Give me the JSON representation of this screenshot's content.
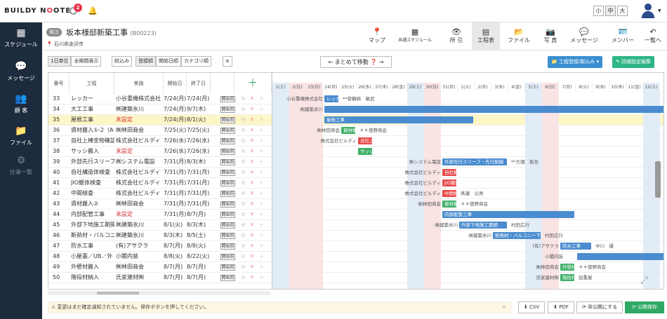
{
  "app": {
    "logo": "BUILDY NOOTE",
    "notif_count": "2"
  },
  "font_size": [
    "小",
    "中",
    "大"
  ],
  "sidebar": [
    {
      "label": "スケジュール",
      "icon": "▦"
    },
    {
      "label": "メッセージ",
      "icon": "✉"
    },
    {
      "label": "顧 客",
      "icon": "👥"
    },
    {
      "label": "ファイル",
      "icon": "📁"
    },
    {
      "label": "仕事一覧",
      "icon": "⚙"
    }
  ],
  "project": {
    "tag": "発注",
    "title": "坂本様邸新築工事",
    "code": "(B00223)",
    "location": "石川県金沢市"
  },
  "nav": [
    {
      "label": "マップ",
      "icon": "📍"
    },
    {
      "label": "共通スケジュール",
      "icon": "▦"
    },
    {
      "label": "所 引",
      "icon": "👁"
    },
    {
      "label": "工程表",
      "icon": "▤"
    },
    {
      "label": "ファイル",
      "icon": "📂"
    },
    {
      "label": "写 真",
      "icon": "📷"
    },
    {
      "label": "メッセージ",
      "icon": "💬"
    },
    {
      "label": "メンバー",
      "icon": "🪪"
    },
    {
      "label": "一覧へ",
      "icon": "↶"
    }
  ],
  "toolbar": {
    "view": [
      "1日単位",
      "全期間表示"
    ],
    "filter": "絞込み",
    "sort": [
      "登録順",
      "開始日順",
      "カテゴリ順"
    ],
    "move": "まとめて移動",
    "register": "工程登録/取込み",
    "settings": "詳細設定編集"
  },
  "columns": {
    "no": "番号",
    "name": "工程",
    "contractor": "実施",
    "start": "開始日",
    "end": "終了日",
    "start_btn": "開始前"
  },
  "dates": [
    "1(土)",
    "2(日)",
    "23(日)",
    "24(月)",
    "25(火)",
    "26(水)",
    "27(木)",
    "28(金)",
    "29(土)",
    "30(日)",
    "31(月)",
    "1(火)",
    "2(水)",
    "3(木)",
    "4(金)",
    "5(土)",
    "6(日)",
    "7(月)",
    "8(火)",
    "9(水)",
    "10(木)",
    "11(金)",
    "12(土)"
  ],
  "rows": [
    {
      "no": "33",
      "name": "レッカー",
      "c": "小谷重機株式会社",
      "s": "7/24(月)",
      "e": "7/24(月)",
      "red": false
    },
    {
      "no": "34",
      "name": "大工工事",
      "c": "㈱建築氷川",
      "s": "7/24(月)",
      "e": "9/7(木)",
      "red": false
    },
    {
      "no": "35",
      "name": "屋根工事",
      "c": "未設定",
      "s": "7/24(月)",
      "e": "8/1(火)",
      "red": true
    },
    {
      "no": "36",
      "name": "資材搬入①-2（A",
      "c": "㈱林田商会",
      "s": "7/25(火)",
      "e": "7/25(火)",
      "red": false
    },
    {
      "no": "37",
      "name": "自社上棟金物確認",
      "c": "株式会社ビルディ",
      "s": "7/26(水)",
      "e": "7/26(水)",
      "red": false
    },
    {
      "no": "38",
      "name": "サッシ搬入",
      "c": "未設定",
      "s": "7/26(水)",
      "e": "7/26(水)",
      "red": true
    },
    {
      "no": "39",
      "name": "外部先行スリーブ",
      "c": "㈱システム電設",
      "s": "7/31(月)",
      "e": "8/3(木)",
      "red": false
    },
    {
      "no": "40",
      "name": "自社構造体検査",
      "c": "株式会社ビルディ",
      "s": "7/31(月)",
      "e": "7/31(月)",
      "red": false
    },
    {
      "no": "41",
      "name": "JIO躯体検査",
      "c": "株式会社ビルディ",
      "s": "7/31(月)",
      "e": "7/31(月)",
      "red": false
    },
    {
      "no": "42",
      "name": "中間検査",
      "c": "株式会社ビルディ",
      "s": "7/31(月)",
      "e": "7/31(月)",
      "red": false
    },
    {
      "no": "43",
      "name": "資材搬入②",
      "c": "㈱林田商会",
      "s": "7/31(月)",
      "e": "7/31(月)",
      "red": false
    },
    {
      "no": "44",
      "name": "内部配管工事",
      "c": "未設定",
      "s": "7/31(月)",
      "e": "8/7(月)",
      "red": true
    },
    {
      "no": "45",
      "name": "外部下地施工期間",
      "c": "㈱建築氷川",
      "s": "8/1(火)",
      "e": "8/3(木)",
      "red": false
    },
    {
      "no": "46",
      "name": "断熱材・バルコニー",
      "c": "㈱建築氷川",
      "s": "8/3(木)",
      "e": "8/5(土)",
      "red": false
    },
    {
      "no": "47",
      "name": "防水工事",
      "c": "(有)アサクラ",
      "s": "8/7(月)",
      "e": "8/8(火)",
      "red": false
    },
    {
      "no": "48",
      "name": "小屋裏／UB／外",
      "c": "小閣内装",
      "s": "8/8(火)",
      "e": "8/22(火)",
      "red": false
    },
    {
      "no": "49",
      "name": "外壁材搬入",
      "c": "㈱林田商会",
      "s": "8/7(月)",
      "e": "8/7(月)",
      "red": false
    },
    {
      "no": "50",
      "name": "階段材納入",
      "c": "氏家建材㈱",
      "s": "8/7(月)",
      "e": "8/7(月)",
      "red": false
    }
  ],
  "gantt": {
    "labels": [
      {
        "r": 0,
        "d": 0,
        "t": "小谷重機株式会社"
      },
      {
        "r": 1,
        "d": 1,
        "t": "㈱建築氷川"
      },
      {
        "r": 3,
        "d": 2,
        "t": "㈱林田商会"
      },
      {
        "r": 4,
        "d": 2,
        "t": "株式会社ビルディ"
      },
      {
        "r": 6,
        "d": 7,
        "t": "㈱システム電設"
      },
      {
        "r": 7,
        "d": 7,
        "t": "株式会社ビルディ"
      },
      {
        "r": 8,
        "d": 7,
        "t": "株式会社ビルディ"
      },
      {
        "r": 9,
        "d": 7,
        "t": "株式会社ビルディ"
      },
      {
        "r": 10,
        "d": 8,
        "t": "㈱林田商会"
      },
      {
        "r": 12,
        "d": 9,
        "t": "㈱建築氷川"
      },
      {
        "r": 13,
        "d": 11,
        "t": "㈱建築氷川"
      },
      {
        "r": 14,
        "d": 15,
        "t": "(有)アサクラ"
      },
      {
        "r": 16,
        "d": 15,
        "t": "㈱林田商会"
      },
      {
        "r": 17,
        "d": 15,
        "t": "氏家建材㈱"
      }
    ],
    "after": [
      {
        "r": 0,
        "d": 4,
        "t": "**菅鶴崎　敏武"
      },
      {
        "r": 3,
        "d": 5,
        "t": "＊＊徳野商会"
      },
      {
        "r": 6,
        "d": 14,
        "t": "**大畑　拓也"
      },
      {
        "r": 9,
        "d": 11,
        "t": "髙瀬　公亮"
      },
      {
        "r": 10,
        "d": 11,
        "t": "＊＊徳野商会"
      },
      {
        "r": 12,
        "d": 14,
        "t": "村田広行"
      },
      {
        "r": 13,
        "d": 16,
        "t": "村田広行"
      },
      {
        "r": 14,
        "d": 19,
        "t": "中川　優"
      },
      {
        "r": 15,
        "d": 16,
        "t": "小閣内装"
      },
      {
        "r": 16,
        "d": 18,
        "t": "＊＊徳野商会"
      },
      {
        "r": 17,
        "d": 18,
        "t": "加重屋"
      }
    ],
    "bars": [
      {
        "r": 0,
        "d0": 3,
        "d1": 3,
        "t": "レッカ",
        "c": "#4a8ccf"
      },
      {
        "r": 1,
        "d0": 3,
        "d1": 23,
        "t": "",
        "c": "#4a8ccf"
      },
      {
        "r": 2,
        "d0": 3,
        "d1": 11,
        "t": "屋根工事",
        "c": "#4a8ccf"
      },
      {
        "r": 3,
        "d0": 4,
        "d1": 4,
        "t": "資材搬",
        "c": "#3fb068"
      },
      {
        "r": 4,
        "d0": 5,
        "d1": 5,
        "t": "自社上",
        "c": "#e84b4b"
      },
      {
        "r": 5,
        "d0": 5,
        "d1": 5,
        "t": "サッシ",
        "c": "#3fb068"
      },
      {
        "r": 6,
        "d0": 10,
        "d1": 13,
        "t": "外部先行スリーブ・先行配線",
        "c": "#4a8ccf"
      },
      {
        "r": 7,
        "d0": 10,
        "d1": 10,
        "t": "自社構",
        "c": "#e84b4b"
      },
      {
        "r": 8,
        "d0": 10,
        "d1": 10,
        "t": "JIO躯体",
        "c": "#e84b4b"
      },
      {
        "r": 9,
        "d0": 10,
        "d1": 10,
        "t": "中間検",
        "c": "#e84b4b"
      },
      {
        "r": 10,
        "d0": 10,
        "d1": 10,
        "t": "資材搬",
        "c": "#3fb068"
      },
      {
        "r": 11,
        "d0": 10,
        "d1": 17,
        "t": "内部配管工事",
        "c": "#4a8ccf"
      },
      {
        "r": 12,
        "d0": 11,
        "d1": 13,
        "t": "外部下地施工期間",
        "c": "#4a8ccf"
      },
      {
        "r": 13,
        "d0": 13,
        "d1": 15,
        "t": "断熱材・バルコニー下地",
        "c": "#4a8ccf"
      },
      {
        "r": 14,
        "d0": 17,
        "d1": 18,
        "t": "防水工事",
        "c": "#4a8ccf"
      },
      {
        "r": 15,
        "d0": 18,
        "d1": 23,
        "t": "",
        "c": "#4a8ccf"
      },
      {
        "r": 16,
        "d0": 17,
        "d1": 17,
        "t": "外壁材",
        "c": "#3fb068"
      },
      {
        "r": 17,
        "d0": 17,
        "d1": 17,
        "t": "階段材",
        "c": "#3fb068"
      }
    ]
  },
  "footer": {
    "warning": "変更はまだ確定通知されていません。保存ボタンを押してください。",
    "csv": "CSV",
    "pdf": "PDF",
    "unpublish": "非公開にする",
    "save": "公開保存"
  }
}
